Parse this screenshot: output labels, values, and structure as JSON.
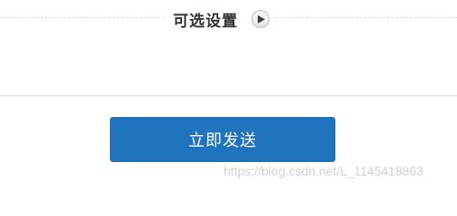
{
  "section": {
    "title": "可选设置",
    "toggle_icon": "play-icon"
  },
  "submit": {
    "label": "立即发送",
    "color": "#1f74bd"
  },
  "watermark": {
    "text": "https://blog.csdn.net/L_1145418863"
  }
}
